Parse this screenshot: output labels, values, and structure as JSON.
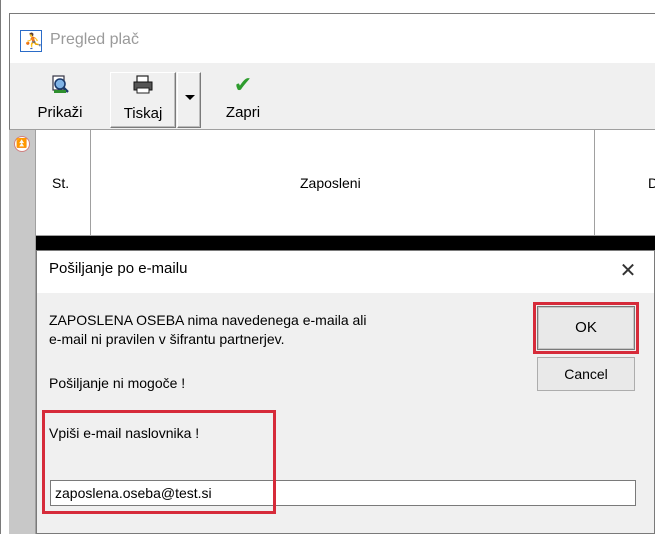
{
  "window": {
    "title": "Pregled plač"
  },
  "toolbar": {
    "buttons": [
      {
        "label": "Prikaži",
        "icon": "preview-icon"
      },
      {
        "label": "Tiskaj",
        "icon": "printer-icon"
      },
      {
        "label": "Zapri",
        "icon": "checkmark-icon"
      }
    ]
  },
  "grid": {
    "columns": [
      "St.",
      "Zaposleni",
      "D"
    ]
  },
  "dialog": {
    "title": "Pošiljanje po e-mailu",
    "message_line1": "ZAPOSLENA OSEBA nima navedenega e-maila ali",
    "message_line2": "e-mail ni pravilen v šifrantu partnerjev.",
    "message_line3": "Pošiljanje ni mogoče !",
    "prompt": "Vpiši e-mail naslovnika !",
    "email_value": "zaposlena.oseba@test.si",
    "ok_label": "OK",
    "cancel_label": "Cancel",
    "close_label": "✕"
  },
  "colors": {
    "highlight": "#d62b3a",
    "check_green": "#2e9c2e"
  }
}
